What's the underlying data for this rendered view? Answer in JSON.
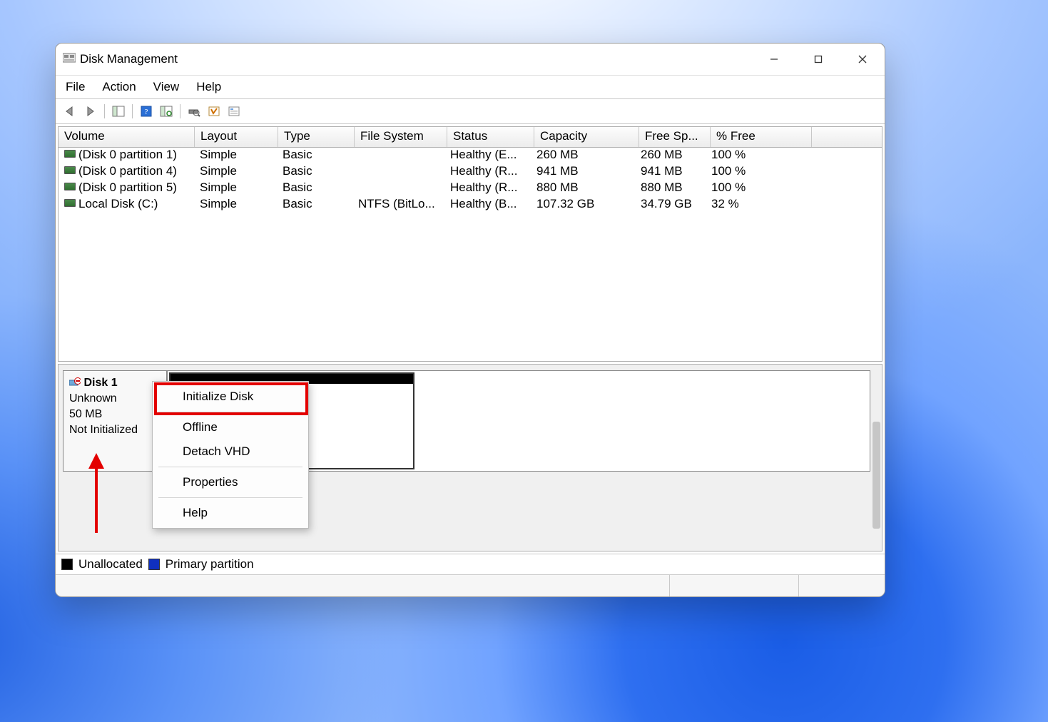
{
  "window": {
    "title": "Disk Management"
  },
  "menubar": [
    "File",
    "Action",
    "View",
    "Help"
  ],
  "columns": [
    "Volume",
    "Layout",
    "Type",
    "File System",
    "Status",
    "Capacity",
    "Free Sp...",
    "% Free"
  ],
  "volumes": [
    {
      "name": "(Disk 0 partition 1)",
      "layout": "Simple",
      "type": "Basic",
      "fs": "",
      "status": "Healthy (E...",
      "cap": "260 MB",
      "free": "260 MB",
      "pct": "100 %"
    },
    {
      "name": "(Disk 0 partition 4)",
      "layout": "Simple",
      "type": "Basic",
      "fs": "",
      "status": "Healthy (R...",
      "cap": "941 MB",
      "free": "941 MB",
      "pct": "100 %"
    },
    {
      "name": "(Disk 0 partition 5)",
      "layout": "Simple",
      "type": "Basic",
      "fs": "",
      "status": "Healthy (R...",
      "cap": "880 MB",
      "free": "880 MB",
      "pct": "100 %"
    },
    {
      "name": "Local Disk (C:)",
      "layout": "Simple",
      "type": "Basic",
      "fs": "NTFS (BitLo...",
      "status": "Healthy (B...",
      "cap": "107.32 GB",
      "free": "34.79 GB",
      "pct": "32 %"
    }
  ],
  "disk": {
    "name": "Disk 1",
    "type": "Unknown",
    "size": "50 MB",
    "state": "Not Initialized"
  },
  "context_menu": {
    "items": [
      "Initialize Disk",
      "Offline",
      "Detach VHD",
      "Properties",
      "Help"
    ],
    "highlighted_index": 0
  },
  "legend": {
    "unallocated": "Unallocated",
    "primary": "Primary partition"
  }
}
